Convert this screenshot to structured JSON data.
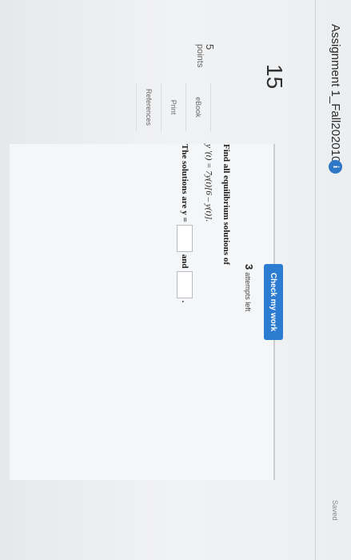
{
  "header": {
    "assignment_title": "Assignment 1_Fall202010",
    "info_glyph": "i",
    "saved_label": "Saved"
  },
  "question": {
    "number": "15",
    "points_value": "5",
    "points_label": "points"
  },
  "sidebar": {
    "items": [
      {
        "label": "eBook"
      },
      {
        "label": "Print"
      },
      {
        "label": "References"
      }
    ]
  },
  "toolbar": {
    "attempts_count": "3",
    "attempts_label": "attempts left",
    "check_label": "Check my work",
    "accent_color": "#2c7cd2"
  },
  "problem": {
    "prompt": "Find all equilibrium solutions of",
    "equation": "y '(t) = 7y(t)[6 – y(t)].",
    "answer_prefix": "The solutions are y =",
    "answer_joiner": "and",
    "answer_suffix": ".",
    "answer_1": "",
    "answer_2": ""
  },
  "icons": [
    "info-icon"
  ]
}
